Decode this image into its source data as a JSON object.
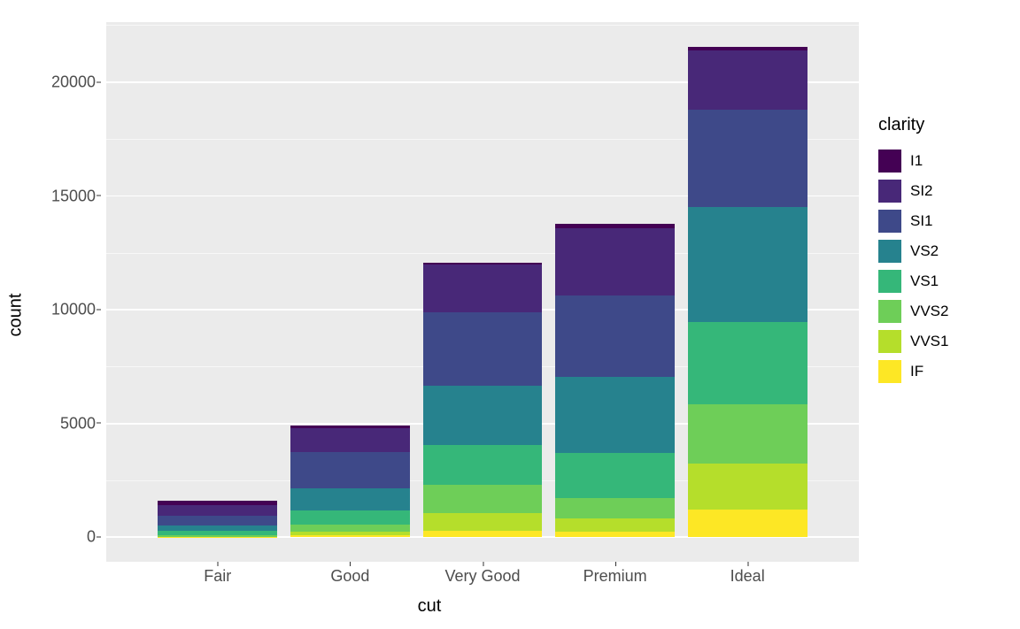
{
  "chart_data": {
    "type": "bar",
    "stacked": true,
    "xlabel": "cut",
    "ylabel": "count",
    "categories": [
      "Fair",
      "Good",
      "Very Good",
      "Premium",
      "Ideal"
    ],
    "series": [
      {
        "name": "IF",
        "color": "#fde725",
        "values": [
          9,
          71,
          268,
          230,
          1212
        ]
      },
      {
        "name": "VVS1",
        "color": "#b5de2b",
        "values": [
          17,
          186,
          789,
          616,
          2047
        ]
      },
      {
        "name": "VVS2",
        "color": "#6ece58",
        "values": [
          69,
          286,
          1235,
          870,
          2606
        ]
      },
      {
        "name": "VS1",
        "color": "#35b779",
        "values": [
          170,
          648,
          1775,
          1989,
          3589
        ]
      },
      {
        "name": "VS2",
        "color": "#26828e",
        "values": [
          261,
          978,
          2591,
          3357,
          5071
        ]
      },
      {
        "name": "SI1",
        "color": "#3e4989",
        "values": [
          408,
          1560,
          3240,
          3575,
          4282
        ]
      },
      {
        "name": "SI2",
        "color": "#482878",
        "values": [
          466,
          1081,
          2100,
          2949,
          2598
        ]
      },
      {
        "name": "I1",
        "color": "#440154",
        "values": [
          210,
          96,
          84,
          205,
          146
        ]
      }
    ],
    "totals": [
      1610,
      4906,
      12082,
      13791,
      21551
    ],
    "xlim_units": 5,
    "ylim": [
      -1080,
      22650
    ],
    "y_ticks": [
      0,
      5000,
      10000,
      15000,
      20000
    ],
    "x_pad_frac": 0.06,
    "bar_width_frac": 0.9,
    "legend_title": "clarity",
    "legend_order": [
      "I1",
      "SI2",
      "SI1",
      "VS2",
      "VS1",
      "VVS2",
      "VVS1",
      "IF"
    ],
    "panel_bg": "#ebebeb"
  }
}
